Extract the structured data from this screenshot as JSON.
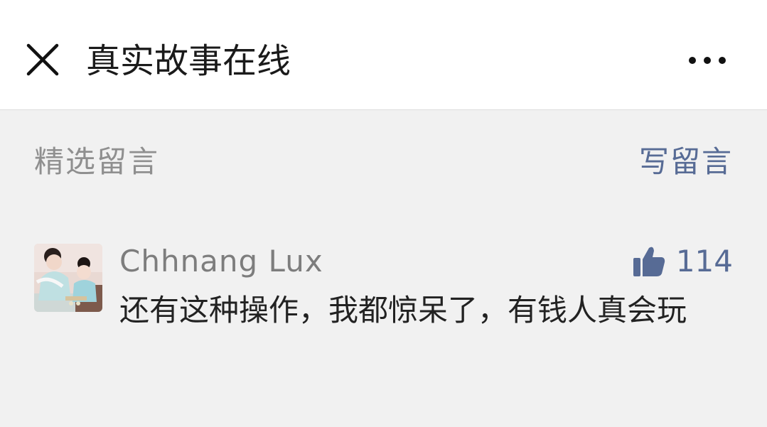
{
  "header": {
    "title": "真实故事在线",
    "close_icon": "close-icon",
    "more_icon": "more-dots-icon"
  },
  "comments_section": {
    "title": "精选留言",
    "write_label": "写留言"
  },
  "comments": [
    {
      "nickname": "Chhnang Lux",
      "likes": "114",
      "text": "还有这种操作，我都惊呆了，有钱人真会玩",
      "avatar_icon": "avatar"
    }
  ],
  "colors": {
    "link": "#576b95",
    "background": "#f1f1f1",
    "header_bg": "#ffffff",
    "muted_text": "#8f8f8f"
  }
}
